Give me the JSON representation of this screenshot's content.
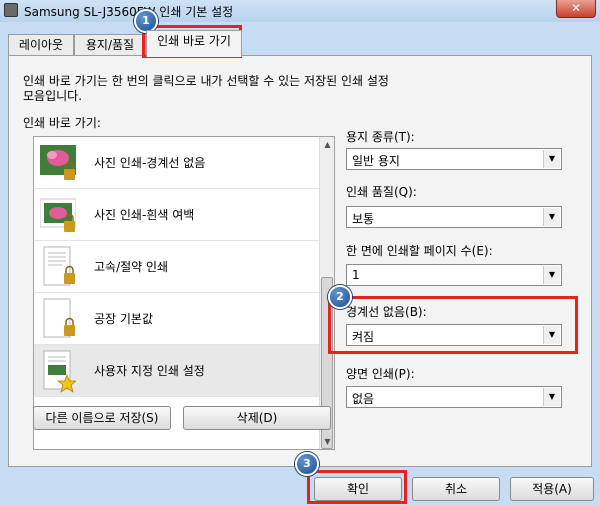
{
  "window": {
    "title": "Samsung SL-J3560FW 인쇄 기본 설정",
    "close_label": "✕"
  },
  "tabs": [
    {
      "label": "레이아웃"
    },
    {
      "label": "용지/품질"
    },
    {
      "label": "인쇄 바로 가기"
    }
  ],
  "description": "인쇄 바로 가기는 한 번의 클릭으로 내가 선택할 수 있는 저장된 인쇄 설정 모음입니다.",
  "list_label": "인쇄 바로 가기:",
  "presets": [
    {
      "label": "사진 인쇄-경계선 없음",
      "thumb": "photo-lock-icon"
    },
    {
      "label": "사진 인쇄-흰색 여백",
      "thumb": "photo-lock-icon"
    },
    {
      "label": "고속/절약 인쇄",
      "thumb": "document-lock-icon"
    },
    {
      "label": "공장 기본값",
      "thumb": "blank-page-lock-icon"
    },
    {
      "label": "사용자 지정 인쇄 설정",
      "thumb": "document-star-icon"
    }
  ],
  "buttons": {
    "save_as": "다른 이름으로 저장(S)",
    "delete": "삭제(D)"
  },
  "fields": {
    "paper_type": {
      "label": "용지 종류(T):",
      "value": "일반 용지"
    },
    "print_quality": {
      "label": "인쇄 품질(Q):",
      "value": "보통"
    },
    "pages_per_side": {
      "label": "한 면에 인쇄할 페이지 수(E):",
      "value": "1"
    },
    "borderless": {
      "label": "경계선 없음(B):",
      "value": "켜짐"
    },
    "duplex": {
      "label": "양면 인쇄(P):",
      "value": "없음"
    }
  },
  "footer": {
    "ok": "확인",
    "cancel": "취소",
    "apply": "적용(A)"
  },
  "callouts": [
    "1",
    "2",
    "3"
  ],
  "colors": {
    "highlight": "#e8231f",
    "callout": "#2a5fa8",
    "window_frame": "#c6dcf2"
  }
}
